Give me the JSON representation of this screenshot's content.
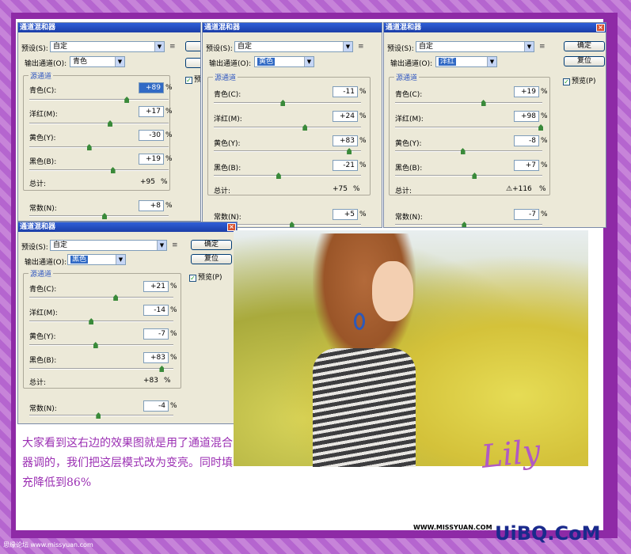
{
  "dialog_title": "通道混和器",
  "labels": {
    "preset": "预设(S):",
    "output": "输出通道(O):",
    "source": "源通道",
    "cyan": "青色(C):",
    "magenta": "洋红(M):",
    "yellow": "黄色(Y):",
    "black": "黑色(B):",
    "total": "总计:",
    "constant": "常数(N):",
    "pct": "%",
    "ok": "确定",
    "reset": "复位",
    "preview": "预览(P)",
    "preview_partial": "预"
  },
  "dialogs": [
    {
      "preset": "自定",
      "output": "青色",
      "cyan": "+89",
      "magenta": "+17",
      "yellow": "-30",
      "black": "+19",
      "total": "+95",
      "constant": "+8",
      "slider_fractions": [
        0.7,
        0.58,
        0.43,
        0.6,
        0.54
      ]
    },
    {
      "preset": "自定",
      "output": "黄色",
      "cyan": "-11",
      "magenta": "+24",
      "yellow": "+83",
      "black": "-21",
      "total": "+75",
      "constant": "+5",
      "slider_fractions": [
        0.47,
        0.62,
        0.92,
        0.44,
        0.53
      ]
    },
    {
      "preset": "自定",
      "output": "洋红",
      "cyan": "+19",
      "magenta": "+98",
      "yellow": "-8",
      "black": "+7",
      "total": "⚠+116",
      "constant": "-7",
      "slider_fractions": [
        0.6,
        0.99,
        0.46,
        0.54,
        0.47
      ]
    },
    {
      "preset": "自定",
      "output": "黑色",
      "cyan": "+21",
      "magenta": "-14",
      "yellow": "-7",
      "black": "+83",
      "total": "+83",
      "constant": "-4",
      "slider_fractions": [
        0.6,
        0.43,
        0.46,
        0.92,
        0.48
      ]
    }
  ],
  "caption": "大家看到这右边的效果图就是用了通道混合器调的，我们把这层模式改为变亮。同时填充降低到86%",
  "lily": "Lily",
  "watermark_left": "思缘论坛 www.missyuan.com",
  "watermark_right": "WWW.MISSYUAN.COM",
  "brand": "UiBQ.CoM",
  "colors": {
    "frame": "#8e2aa6",
    "caption": "#9b2fb3",
    "brand": "#1a2a8c"
  }
}
